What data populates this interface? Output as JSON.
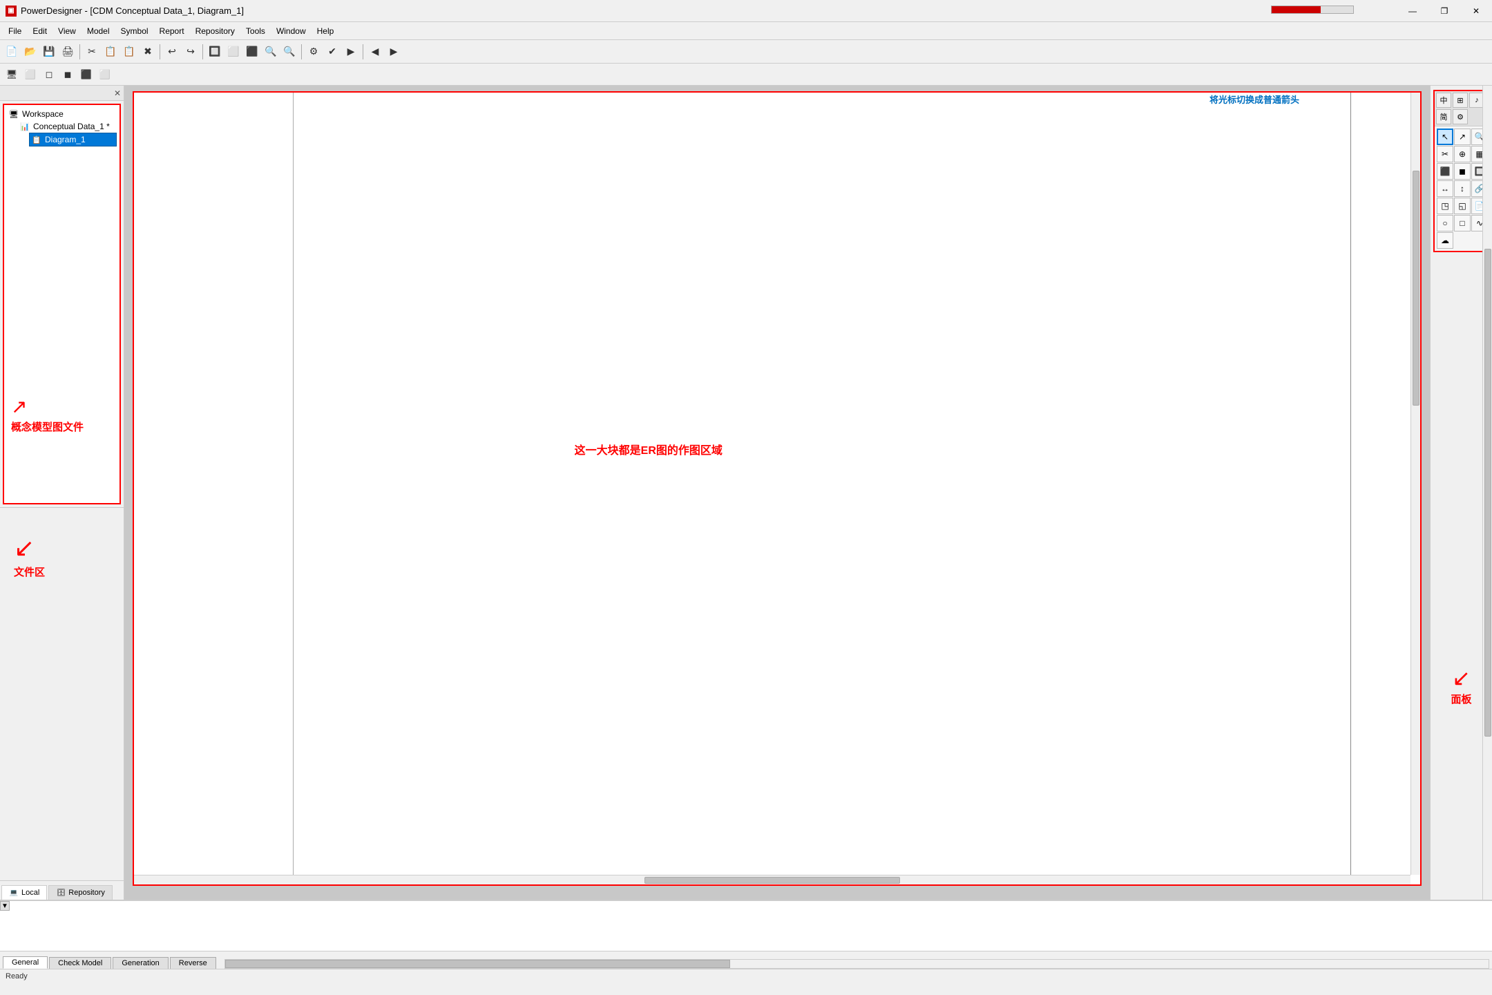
{
  "titleBar": {
    "appIcon": "▣",
    "title": "PowerDesigner - [CDM Conceptual Data_1, Diagram_1]",
    "minBtn": "—",
    "restoreBtn": "❐",
    "closeBtn": "✕",
    "innerMin": "—",
    "innerRestore": "❐",
    "innerClose": "✕"
  },
  "menuBar": {
    "items": [
      "File",
      "Edit",
      "View",
      "Model",
      "Symbol",
      "Report",
      "Repository",
      "Tools",
      "Window",
      "Help"
    ]
  },
  "toolbar1": {
    "buttons": [
      "📄",
      "📂",
      "💾",
      "🖨",
      "✂",
      "📋",
      "📋",
      "✖",
      "↩",
      "↪",
      "🔲",
      "🔵",
      "📦",
      "📊",
      "📋",
      "🖼",
      "✏",
      "🔤",
      "⬆",
      "⬇"
    ]
  },
  "toolbar2": {
    "buttons": [
      "🖥",
      "⬜",
      "◻",
      "◼",
      "⬛",
      "⬜"
    ]
  },
  "leftPanel": {
    "tabs": [
      {
        "id": "local",
        "label": "Local",
        "icon": "💻"
      },
      {
        "id": "repository",
        "label": "Repository",
        "icon": "🗄"
      }
    ],
    "tree": {
      "workspace": "Workspace",
      "model": "Conceptual Data_1 *",
      "diagram": "Diagram_1"
    },
    "annotations": {
      "modelFile": "概念模型图文件",
      "fileArea": "文件区"
    }
  },
  "canvas": {
    "annotation": "这一大块都是ER图的作图区域"
  },
  "toolbox": {
    "header": {
      "modes": [
        "中",
        "中",
        "♪",
        "简",
        "⚙"
      ]
    },
    "annotation": {
      "cursor": "将光标切换成普通箭头",
      "panel": "面板"
    },
    "tools": [
      {
        "icon": "↖",
        "label": "select",
        "active": true
      },
      {
        "icon": "↗",
        "label": "select2"
      },
      {
        "icon": "🔍",
        "label": "zoom"
      },
      {
        "icon": "✂",
        "label": "cut"
      },
      {
        "icon": "🔍",
        "label": "zoom2"
      },
      {
        "icon": "▦",
        "label": "table"
      },
      {
        "icon": "⬛",
        "label": "entity"
      },
      {
        "icon": "◼",
        "label": "entity2"
      },
      {
        "icon": "🔲",
        "label": "frame"
      },
      {
        "icon": "↔",
        "label": "relation"
      },
      {
        "icon": "↕",
        "label": "relation2"
      },
      {
        "icon": "🔗",
        "label": "link"
      },
      {
        "icon": "◳",
        "label": "inherit"
      },
      {
        "icon": "◱",
        "label": "inherit2"
      },
      {
        "icon": "📄",
        "label": "note"
      },
      {
        "icon": "○",
        "label": "oval"
      },
      {
        "icon": "□",
        "label": "rect"
      },
      {
        "icon": "∿",
        "label": "wave"
      },
      {
        "icon": "☁",
        "label": "cloud"
      }
    ]
  },
  "bottomPanel": {
    "tabs": [
      "General",
      "Check Model",
      "Generation",
      "Reverse"
    ]
  },
  "statusBar": {
    "text": "Ready"
  }
}
